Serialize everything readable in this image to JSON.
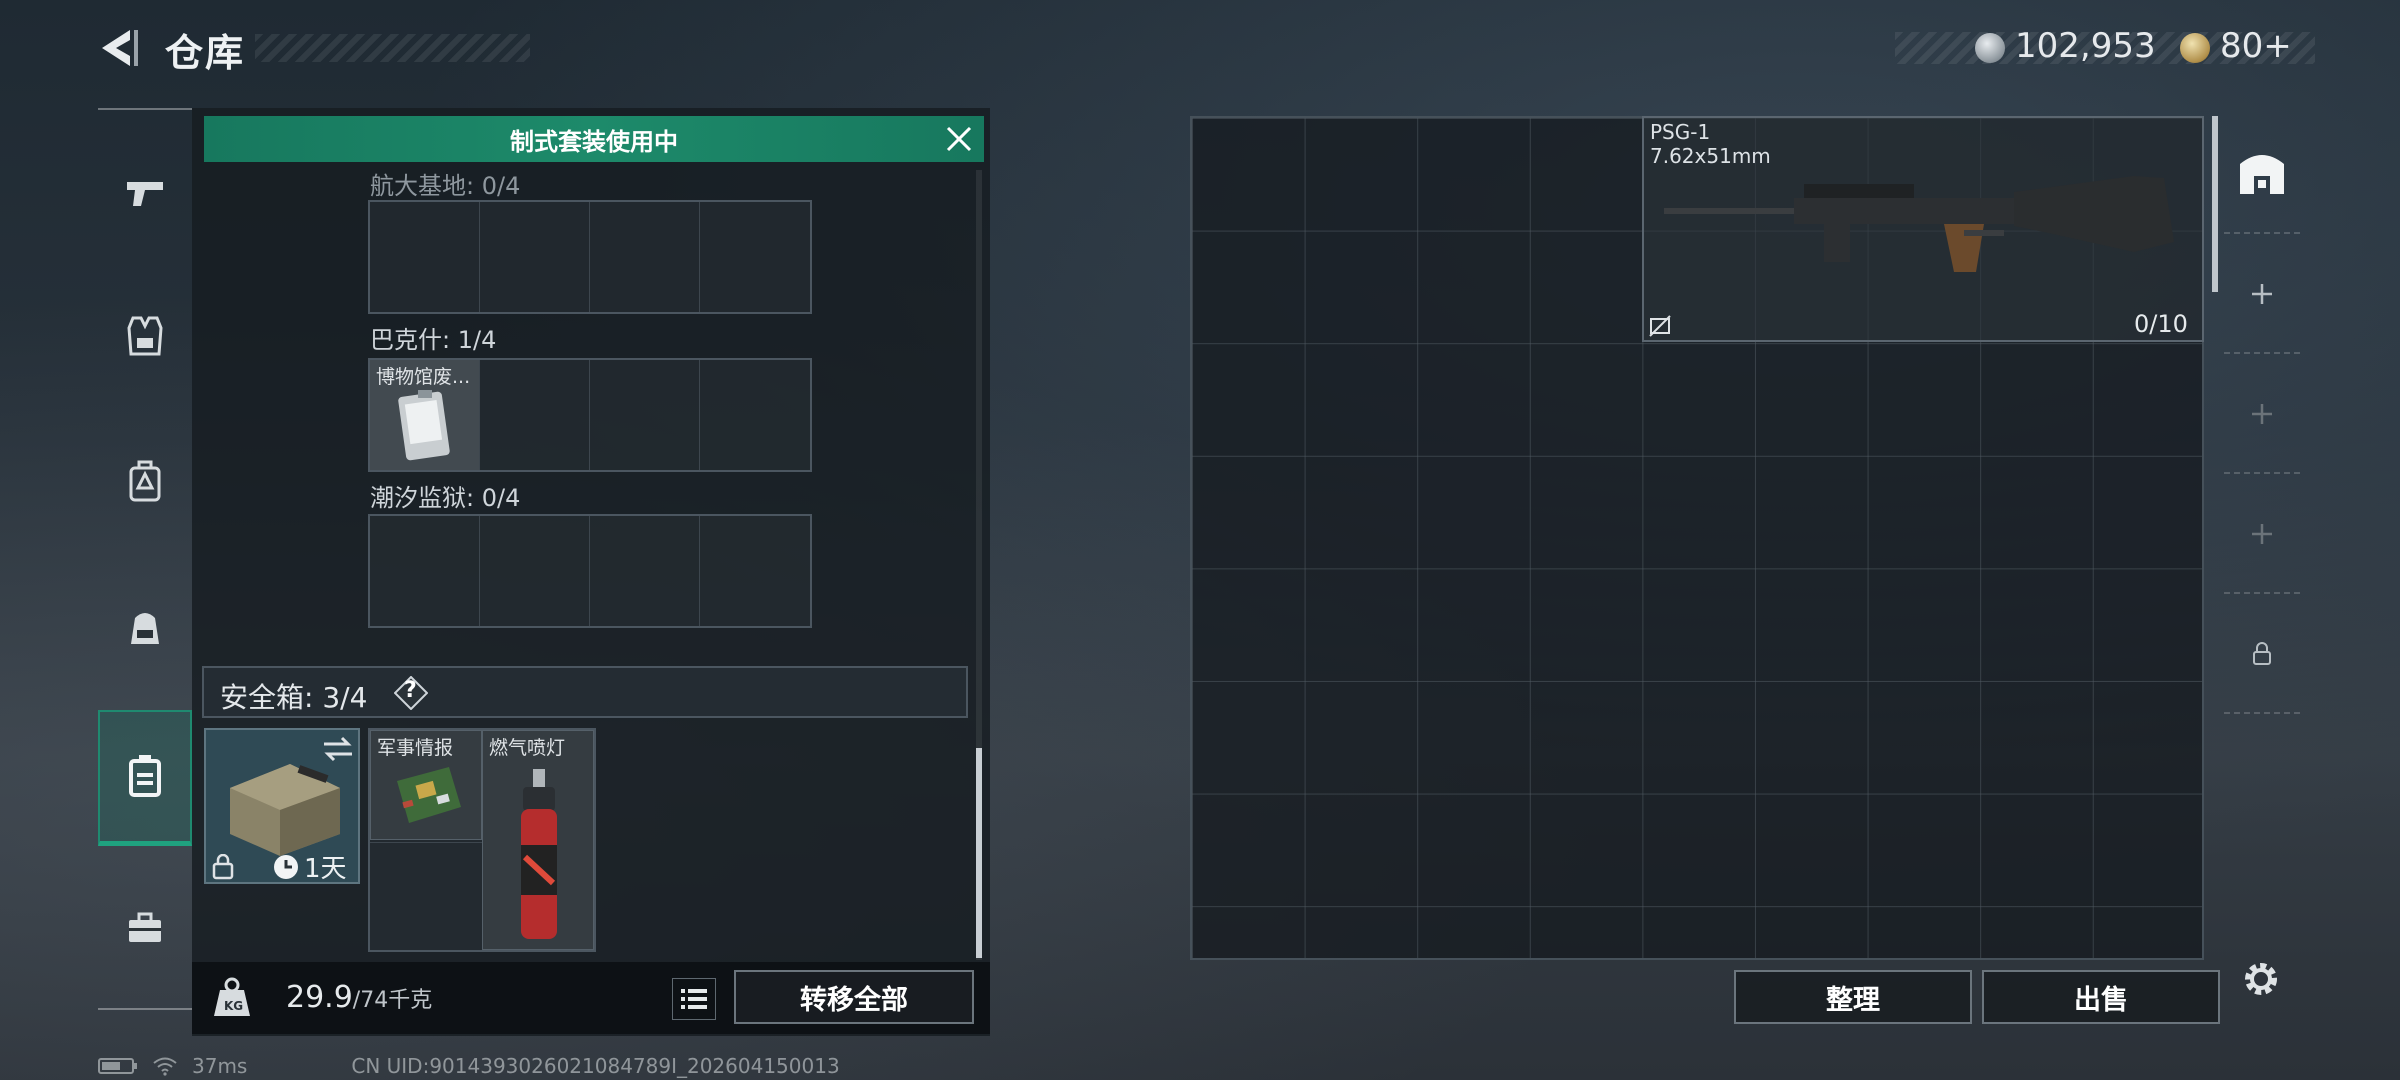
{
  "header": {
    "title": "仓库",
    "currency_silver": "102,953",
    "currency_gold": "80+"
  },
  "left_nav": {
    "items": [
      {
        "name": "weapons",
        "icon": "pistol-icon"
      },
      {
        "name": "armor",
        "icon": "vest-icon"
      },
      {
        "name": "chest-rig",
        "icon": "chest-rig-icon"
      },
      {
        "name": "backpack",
        "icon": "backpack-icon"
      },
      {
        "name": "safebox",
        "icon": "safebox-icon",
        "active": true
      },
      {
        "name": "toolbox",
        "icon": "toolbox-icon"
      }
    ]
  },
  "banner": {
    "text": "制式套装使用中"
  },
  "collections": [
    {
      "label": "航大基地: 0/4",
      "items": []
    },
    {
      "label": "巴克什: 1/4",
      "items": [
        {
          "name": "博物馆废..."
        }
      ]
    },
    {
      "label": "潮汐监狱: 0/4",
      "items": []
    }
  ],
  "safebox": {
    "label": "安全箱: 3/4",
    "help": "?",
    "timer": "1天",
    "items": [
      {
        "name": "军事情报"
      },
      {
        "name": "燃气喷灯"
      }
    ]
  },
  "footer_left": {
    "weight_current": "29.9",
    "weight_max": "/74千克",
    "transfer_all": "转移全部"
  },
  "stash": {
    "item_name": "PSG-1",
    "item_caliber": "7.62x51mm",
    "item_ammo": "0/10"
  },
  "footer_right": {
    "sort": "整理",
    "sell": "出售"
  },
  "status": {
    "ping": "37ms",
    "uid": "CN UID:9014393026021084789I_202604150013"
  }
}
